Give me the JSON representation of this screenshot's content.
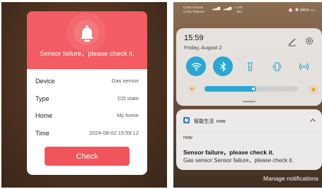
{
  "left": {
    "alert_title": "Sensor failure，please check it.",
    "rows": [
      {
        "label": "Device",
        "value": "Gas sensor"
      },
      {
        "label": "Type",
        "value": "CO state"
      },
      {
        "label": "Home",
        "value": "My home"
      },
      {
        "label": "Time",
        "value": "2024-08-02 15:59:12"
      }
    ],
    "button_label": "Check",
    "accent_color": "#f25c62"
  },
  "right": {
    "status": {
      "carrier_1": "China Unicom",
      "carrier_2": "China Telecom",
      "speed_top": "276",
      "speed_unit": "B/s",
      "battery": "46%"
    },
    "quick_settings": {
      "time": "15:59",
      "date": "Friday, August 2",
      "tiles": [
        {
          "icon": "wifi-icon",
          "on": true
        },
        {
          "icon": "bluetooth-icon",
          "on": true
        },
        {
          "icon": "flashlight-icon",
          "on": false
        },
        {
          "icon": "vibrate-icon",
          "on": false
        },
        {
          "icon": "hotspot-icon",
          "on": false
        }
      ],
      "brightness_fraction": 0.55,
      "accent_color": "#2aa7d3"
    },
    "notification": {
      "app_name": "智能生活",
      "time_label": "now",
      "when": "now",
      "title": "Sensor failure，please check it.",
      "body": "Gas sensor  Sensor failure，please check it."
    },
    "manage_label": "Manage notifications"
  }
}
